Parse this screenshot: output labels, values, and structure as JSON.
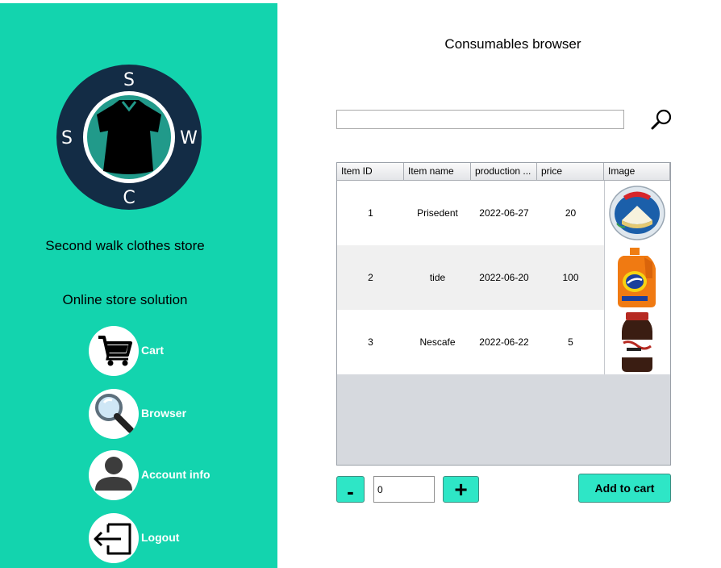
{
  "sidebar": {
    "logo": {
      "letters": {
        "top": "S",
        "left": "S",
        "right": "W",
        "bottom": "C"
      },
      "colors": {
        "ring": "#132c45",
        "inner": "#219a8a",
        "shirt": "#000000"
      }
    },
    "store_name": "Second walk clothes store",
    "tagline": "Online store solution",
    "nav": [
      {
        "label": "Cart",
        "icon": "cart-icon"
      },
      {
        "label": "Browser",
        "icon": "magnifier-icon"
      },
      {
        "label": "Account info",
        "icon": "user-icon"
      },
      {
        "label": "Logout",
        "icon": "logout-icon"
      }
    ],
    "background": "#13d4ae"
  },
  "main": {
    "title": "Consumables browser",
    "search": {
      "value": "",
      "placeholder": "",
      "icon": "search-icon"
    },
    "table": {
      "columns": [
        "Item ID",
        "Item name",
        "production ...",
        "price",
        "Image"
      ],
      "rows": [
        {
          "id": "1",
          "name": "Prisedent",
          "production": "2022-06-27",
          "price": "20",
          "image": "president-cheese-image"
        },
        {
          "id": "2",
          "name": "tide",
          "production": "2022-06-20",
          "price": "100",
          "image": "tide-detergent-image"
        },
        {
          "id": "3",
          "name": "Nescafe",
          "production": "2022-06-22",
          "price": "5",
          "image": "nescafe-jar-image"
        }
      ]
    },
    "quantity": {
      "minus_label": "-",
      "value": "0",
      "plus_label": "+"
    },
    "add_to_cart_label": "Add to cart",
    "accent": "#2ee6c6"
  }
}
